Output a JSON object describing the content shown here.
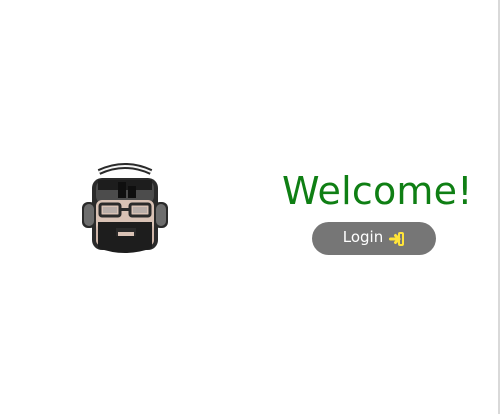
{
  "page": {
    "avatar": {
      "name": "pixel-avatar",
      "colors": {
        "outline": "#2a2a2a",
        "headphones": "#6d6d6d",
        "hair": "#4c4c4c",
        "hair_dark": "#1d1d1d",
        "skin": "#d9c2b5",
        "skin_shadow": "#bfa596",
        "glasses": "#9c9c9c",
        "white": "#f6f6f6"
      }
    },
    "welcome_text": "Welcome!",
    "login_button": {
      "label": "Login",
      "icon": "sign-in-icon",
      "colors": {
        "background": "#767676",
        "text": "#ffffff",
        "icon": "#ffe43a"
      }
    },
    "accent_color": "#0f7f14"
  }
}
